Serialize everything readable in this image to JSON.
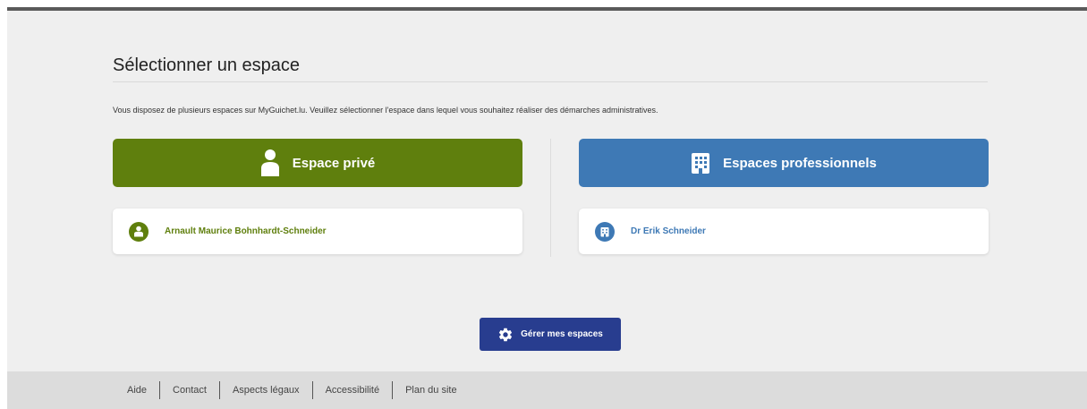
{
  "header": {
    "title": "Sélectionner un espace",
    "intro": "Vous disposez de plusieurs espaces sur MyGuichet.lu. Veuillez sélectionner l'espace dans lequel vous souhaitez réaliser des démarches administratives."
  },
  "private_space": {
    "button_label": "Espace privé",
    "button_icon": "person-icon",
    "user_name": "Arnault Maurice Bohnhardt-Schneider",
    "user_icon": "person-icon"
  },
  "professional_space": {
    "button_label": "Espaces professionnels",
    "button_icon": "building-icon",
    "entity_name": "Dr Erik Schneider",
    "entity_icon": "building-icon"
  },
  "manage": {
    "label": "Gérer mes espaces",
    "icon": "gear-icon"
  },
  "footer": {
    "links": [
      "Aide",
      "Contact",
      "Aspects légaux",
      "Accessibilité",
      "Plan du site"
    ]
  },
  "colors": {
    "private_green": "#5f7f0d",
    "professional_blue": "#3e79b5",
    "manage_navy": "#283d8f",
    "background": "#efefef",
    "footer_background": "#dcdcdc"
  }
}
